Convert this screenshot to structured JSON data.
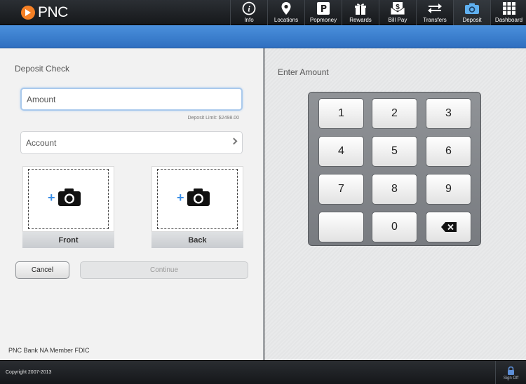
{
  "brand": {
    "name": "PNC"
  },
  "nav": {
    "items": [
      {
        "label": "Info",
        "icon": "info-icon"
      },
      {
        "label": "Locations",
        "icon": "map-pin-icon"
      },
      {
        "label": "Popmoney",
        "icon": "popmoney-icon"
      },
      {
        "label": "Rewards",
        "icon": "gift-icon"
      },
      {
        "label": "Bill Pay",
        "icon": "bill-pay-icon"
      },
      {
        "label": "Transfers",
        "icon": "transfer-arrows-icon"
      },
      {
        "label": "Deposit",
        "icon": "camera-icon",
        "active": true
      },
      {
        "label": "Dashboard",
        "icon": "grid-icon"
      }
    ]
  },
  "deposit": {
    "title": "Deposit Check",
    "amount_placeholder": "Amount",
    "deposit_limit": "Deposit Limit: $2498.00",
    "account_placeholder": "Account",
    "front_label": "Front",
    "back_label": "Back",
    "cancel_label": "Cancel",
    "continue_label": "Continue",
    "fdic": "PNC Bank NA Member FDIC"
  },
  "keypad": {
    "title": "Enter Amount",
    "keys": [
      "1",
      "2",
      "3",
      "4",
      "5",
      "6",
      "7",
      "8",
      "9",
      "",
      "0",
      "backspace"
    ]
  },
  "footer": {
    "copyright": "Copyright 2007-2013",
    "signoff_label": "Sign Off"
  },
  "colors": {
    "brand_orange": "#f58025",
    "header_blue": "#3b7fd0",
    "accent_blue": "#3a8ee6"
  }
}
